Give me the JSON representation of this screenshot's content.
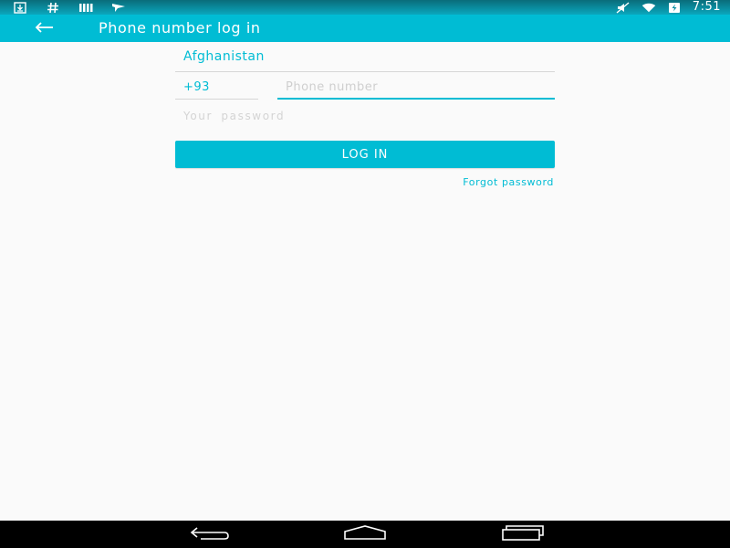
{
  "status_bar": {
    "left_icons": [
      "download-icon",
      "hash-icon",
      "signal-bars-icon",
      "plane-flag-icon"
    ],
    "right_icons": [
      "mute-icon",
      "wifi-icon",
      "battery-charging-icon"
    ],
    "time": "7:51"
  },
  "app_bar": {
    "back_icon": "arrow-left-icon",
    "title": "Phone number log in"
  },
  "form": {
    "country": "Afghanistan",
    "country_code": "+93",
    "phone_placeholder": "Phone number",
    "password_placeholder": "Your password",
    "login_label": "LOG IN",
    "forgot_label": "Forgot password"
  },
  "nav_bar": {
    "buttons": [
      "back-nav-icon",
      "home-nav-icon",
      "recents-nav-icon"
    ]
  },
  "colors": {
    "accent": "#00bcd4",
    "status_bar": "#0a8fa3",
    "background": "#fafafa",
    "divider": "#d6d6d6",
    "nav_bar": "#000000"
  }
}
